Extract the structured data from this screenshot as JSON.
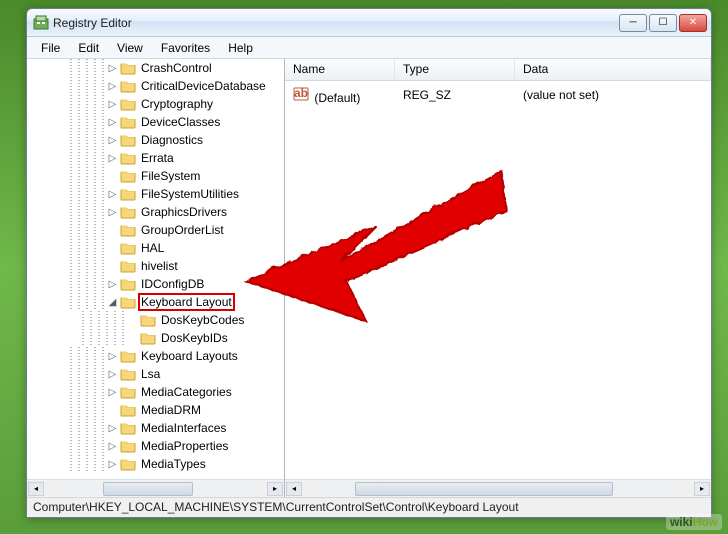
{
  "window": {
    "title": "Registry Editor"
  },
  "menu": {
    "file": "File",
    "edit": "Edit",
    "view": "View",
    "favorites": "Favorites",
    "help": "Help"
  },
  "tree": {
    "items": [
      {
        "label": "CrashControl",
        "exp": "▷",
        "depth": 7
      },
      {
        "label": "CriticalDeviceDatabase",
        "exp": "▷",
        "depth": 7
      },
      {
        "label": "Cryptography",
        "exp": "▷",
        "depth": 7
      },
      {
        "label": "DeviceClasses",
        "exp": "▷",
        "depth": 7
      },
      {
        "label": "Diagnostics",
        "exp": "▷",
        "depth": 7
      },
      {
        "label": "Errata",
        "exp": "▷",
        "depth": 7
      },
      {
        "label": "FileSystem",
        "exp": "",
        "depth": 7
      },
      {
        "label": "FileSystemUtilities",
        "exp": "▷",
        "depth": 7
      },
      {
        "label": "GraphicsDrivers",
        "exp": "▷",
        "depth": 7
      },
      {
        "label": "GroupOrderList",
        "exp": "",
        "depth": 7
      },
      {
        "label": "HAL",
        "exp": "",
        "depth": 7
      },
      {
        "label": "hivelist",
        "exp": "",
        "depth": 7
      },
      {
        "label": "IDConfigDB",
        "exp": "▷",
        "depth": 7
      },
      {
        "label": "Keyboard Layout",
        "exp": "◢",
        "depth": 7,
        "selected": true
      },
      {
        "label": "DosKeybCodes",
        "exp": "",
        "depth": 8
      },
      {
        "label": "DosKeybIDs",
        "exp": "",
        "depth": 8
      },
      {
        "label": "Keyboard Layouts",
        "exp": "▷",
        "depth": 7
      },
      {
        "label": "Lsa",
        "exp": "▷",
        "depth": 7
      },
      {
        "label": "MediaCategories",
        "exp": "▷",
        "depth": 7
      },
      {
        "label": "MediaDRM",
        "exp": "",
        "depth": 7
      },
      {
        "label": "MediaInterfaces",
        "exp": "▷",
        "depth": 7
      },
      {
        "label": "MediaProperties",
        "exp": "▷",
        "depth": 7
      },
      {
        "label": "MediaTypes",
        "exp": "▷",
        "depth": 7
      }
    ]
  },
  "list": {
    "cols": {
      "name": "Name",
      "type": "Type",
      "data": "Data"
    },
    "row": {
      "name": "(Default)",
      "type": "REG_SZ",
      "data": "(value not set)"
    }
  },
  "status": {
    "path": "Computer\\HKEY_LOCAL_MACHINE\\SYSTEM\\CurrentControlSet\\Control\\Keyboard Layout"
  },
  "watermark": {
    "wiki": "wiki",
    "how": "How"
  }
}
